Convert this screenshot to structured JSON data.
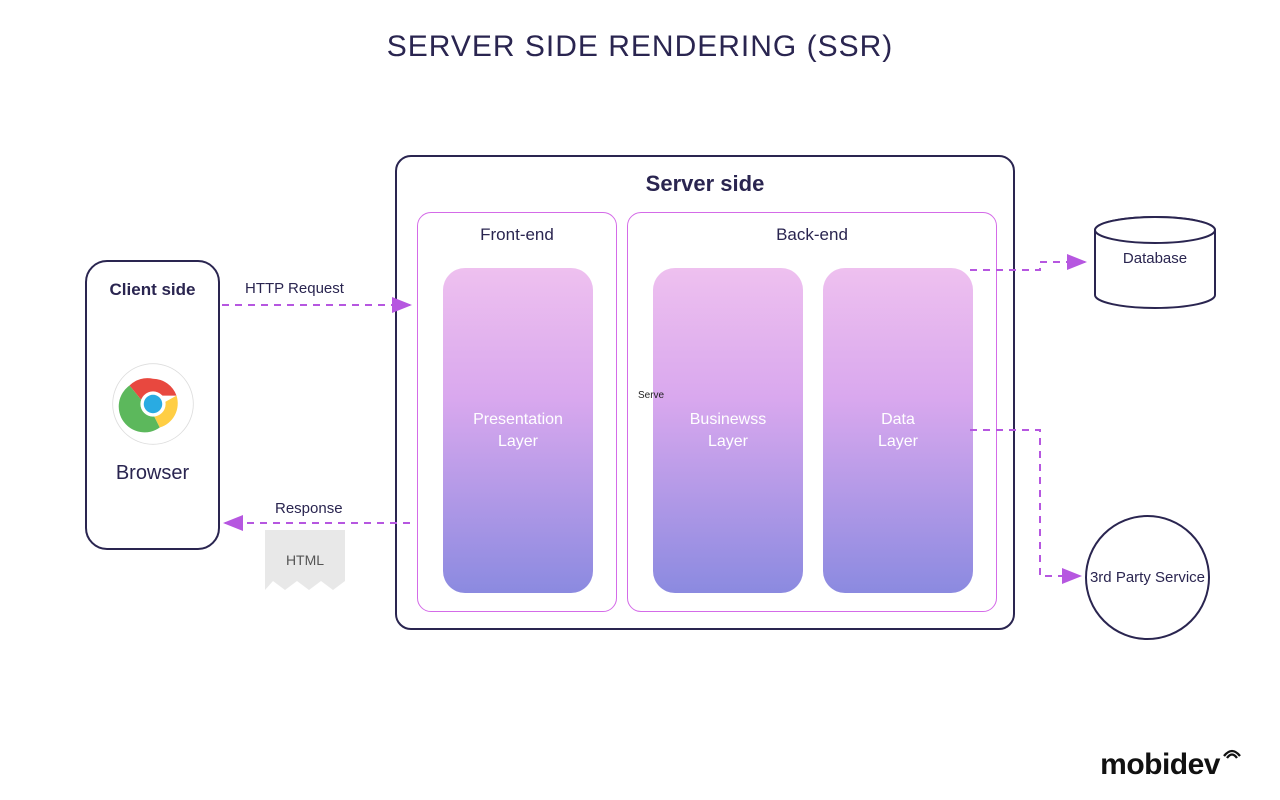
{
  "title": "SERVER SIDE RENDERING (SSR)",
  "client": {
    "box_title": "Client side",
    "browser_label": "Browser"
  },
  "server": {
    "box_title": "Server side",
    "frontend_title": "Front-end",
    "backend_title": "Back-end",
    "layers": {
      "presentation": "Presentation\nLayer",
      "business": "Businewss\nLayer",
      "data": "Data\nLayer"
    }
  },
  "arrows": {
    "http_request": "HTTP Request",
    "response": "Response"
  },
  "html_note": "HTML",
  "external": {
    "database": "Database",
    "third_party": "3rd Party Service"
  },
  "tiny_label": "Serve",
  "logo_text": "mobidev"
}
